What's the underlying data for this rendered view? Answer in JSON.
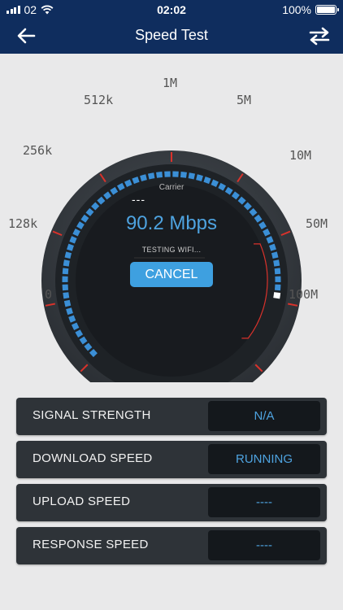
{
  "status_bar": {
    "carrier": "02",
    "time": "02:02",
    "battery": "100%"
  },
  "nav": {
    "title": "Speed Test"
  },
  "gauge": {
    "scale_labels": [
      "0",
      "128k",
      "256k",
      "512k",
      "1M",
      "5M",
      "10M",
      "50M",
      "100M"
    ],
    "progress_fraction": 0.85,
    "carrier_label": "Carrier",
    "carrier_value": "---",
    "speed": "90.2 Mbps",
    "testing": "TESTING WIFI...",
    "cancel_label": "CANCEL"
  },
  "metrics": [
    {
      "label": "SIGNAL STRENGTH",
      "value": "N/A"
    },
    {
      "label": "DOWNLOAD SPEED",
      "value": "RUNNING"
    },
    {
      "label": "UPLOAD SPEED",
      "value": "----"
    },
    {
      "label": "RESPONSE SPEED",
      "value": "----"
    }
  ],
  "colors": {
    "navbar": "#0f2d5e",
    "accent": "#3ea0e0",
    "tick_red": "#d9322b",
    "panel": "#2e3338"
  }
}
